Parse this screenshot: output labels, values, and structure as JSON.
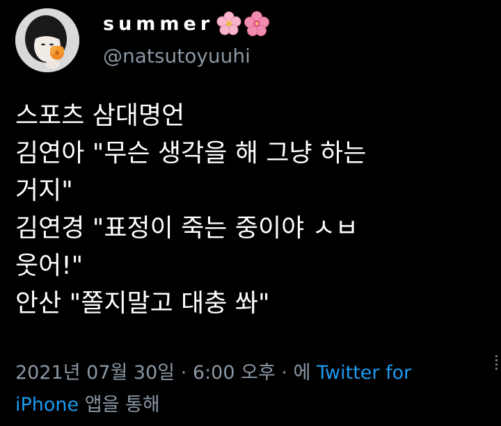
{
  "user": {
    "display_name": "summer",
    "emoji_icons": [
      "cherry-blossom-icon",
      "hibiscus-icon"
    ],
    "handle": "@natsutoyuuhi"
  },
  "tweet": {
    "lines": [
      "스포츠 삼대명언",
      "김연아 \"무슨 생각을 해 그냥 하는",
      "거지\"",
      "김연경 \"표정이 죽는 중이야 ㅅㅂ",
      "웃어!\"",
      "안산 \"쫄지말고 대충 쏴\""
    ]
  },
  "meta": {
    "date": "2021년 07월 30일",
    "separator": "·",
    "time": "6:00 오후",
    "via_prefix": "에",
    "source_part1": "Twitter for",
    "source_part2": "iPhone",
    "via_suffix": "앱을 통해"
  },
  "colors": {
    "background": "#000000",
    "text": "#ffffff",
    "muted": "#8b98a5",
    "link": "#1d9bf0"
  }
}
